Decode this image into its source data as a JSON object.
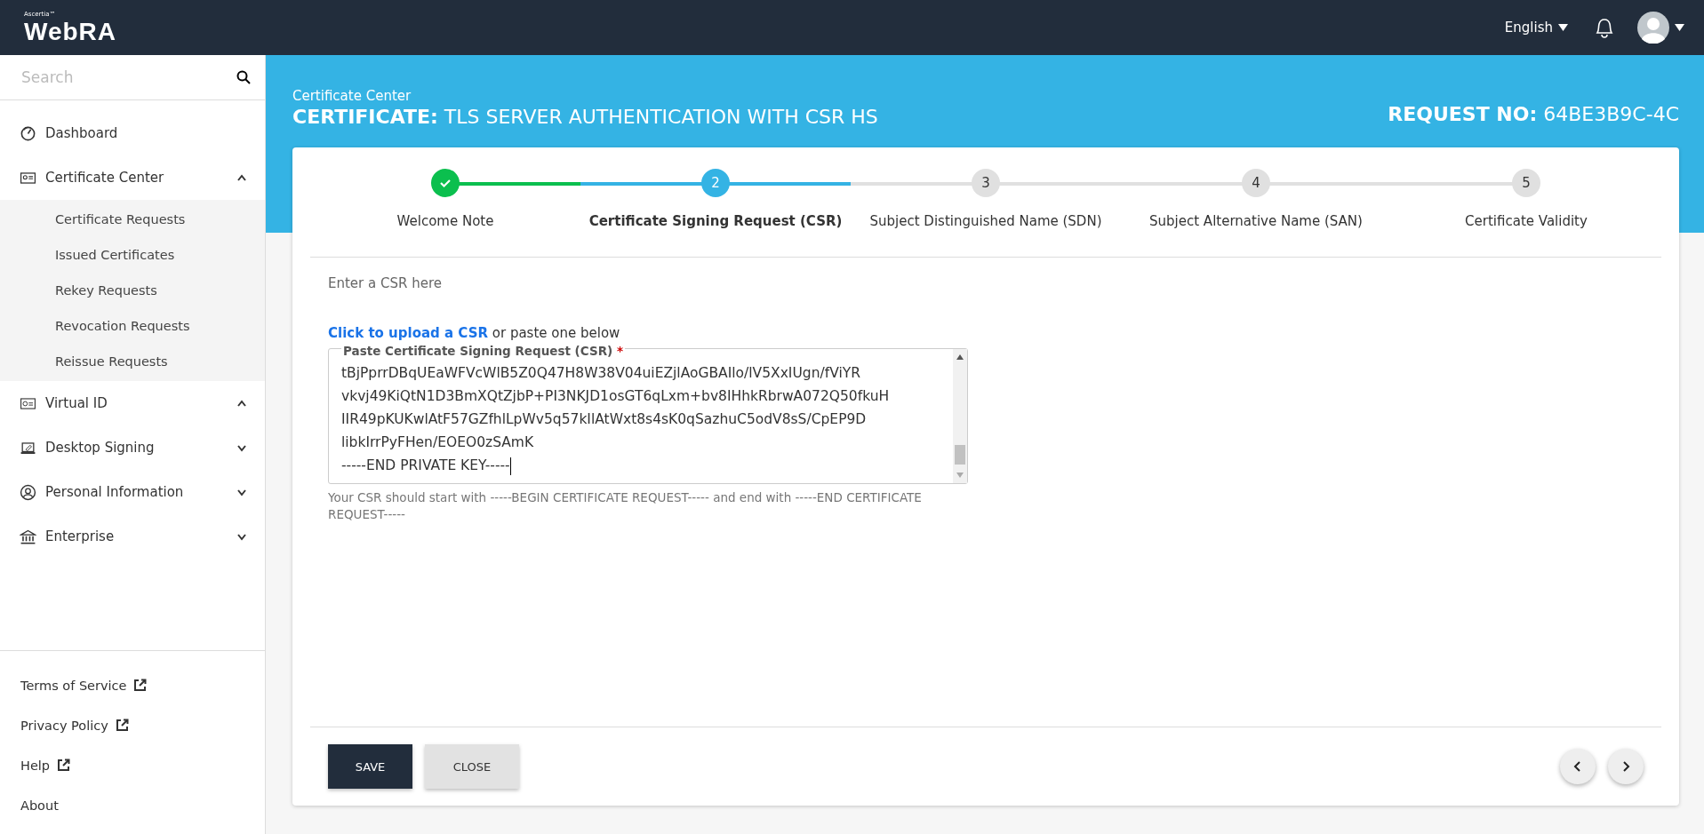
{
  "header": {
    "brand_small": "Ascertia™",
    "brand": "WebRA",
    "language": "English"
  },
  "sidebar": {
    "search": {
      "placeholder": "Search"
    },
    "items": [
      {
        "label": "Dashboard",
        "kind": "link"
      },
      {
        "label": "Certificate Center",
        "kind": "group",
        "expanded": true,
        "children": [
          {
            "label": "Certificate Requests"
          },
          {
            "label": "Issued Certificates"
          },
          {
            "label": "Rekey Requests"
          },
          {
            "label": "Revocation Requests"
          },
          {
            "label": "Reissue Requests"
          }
        ]
      },
      {
        "label": "Virtual ID",
        "kind": "group",
        "expanded": true
      },
      {
        "label": "Desktop Signing",
        "kind": "group",
        "expanded": false
      },
      {
        "label": "Personal Information",
        "kind": "group",
        "expanded": false
      },
      {
        "label": "Enterprise",
        "kind": "group",
        "expanded": false
      }
    ],
    "footer_links": [
      {
        "label": "Terms of Service",
        "external": true
      },
      {
        "label": "Privacy Policy",
        "external": true
      },
      {
        "label": "Help",
        "external": true
      },
      {
        "label": "About",
        "external": false
      }
    ]
  },
  "banner": {
    "section": "Certificate Center",
    "title_label": "CERTIFICATE:",
    "title": "TLS SERVER AUTHENTICATION WITH CSR HS",
    "request_label": "REQUEST NO:",
    "request_no": "64BE3B9C-4C"
  },
  "steps": [
    {
      "label": "Welcome Note",
      "completed": true,
      "selected": false
    },
    {
      "number": "2",
      "label": "Certificate Signing Request (CSR)",
      "completed": false,
      "selected": true
    },
    {
      "number": "3",
      "label": "Subject Distinguished Name (SDN)",
      "completed": false,
      "selected": false
    },
    {
      "number": "4",
      "label": "Subject Alternative Name (SAN)",
      "completed": false,
      "selected": false
    },
    {
      "number": "5",
      "label": "Certificate Validity",
      "completed": false,
      "selected": false
    }
  ],
  "form": {
    "intro": "Enter a CSR here",
    "upload_link": "Click to upload a CSR",
    "upload_rest": "or paste one below",
    "csr_label": "Paste Certificate Signing Request (CSR)",
    "required_mark": "*",
    "csr_lines": [
      "tBjPprrDBqUEaWFVcWlB5Z0Q47H8W38V04uiEZjlAoGBAIlo/lV5XxIUgn/fViYR",
      "vkvj49KiQtN1D3BmXQtZjbP+PI3NKJD1osGT6qLxm+bv8IHhkRbrwA072Q50fkuH",
      "IIR49pKUKwlAtF57GZfhlLpWv5q57kIlAtWxt8s4sK0qSazhuC5odV8sS/CpEP9D",
      "libkIrrPyFHen/EOEO0zSAmK",
      "-----END PRIVATE KEY-----"
    ],
    "hint": "Your CSR should start with -----BEGIN CERTIFICATE REQUEST----- and end with -----END CERTIFICATE REQUEST-----"
  },
  "buttons": [
    {
      "label": "SAVE",
      "kind": "primary"
    },
    {
      "label": "CLOSE",
      "kind": "secondary"
    }
  ]
}
